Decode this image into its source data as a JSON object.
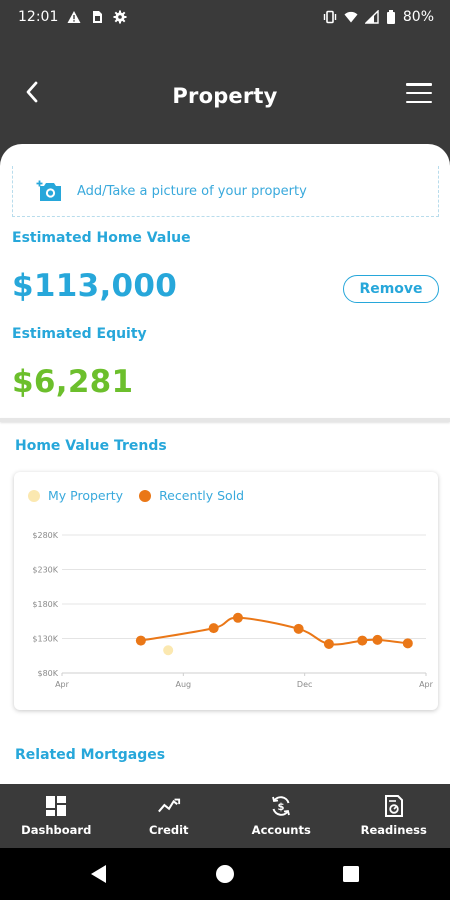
{
  "status_bar": {
    "time": "12:01",
    "battery": "80%",
    "left_icons": [
      "warning-icon",
      "sim-icon",
      "gear-icon"
    ],
    "right_icons": [
      "vibrate-icon",
      "wifi-icon",
      "signal-icon",
      "battery-icon"
    ]
  },
  "header": {
    "title": "Property",
    "back_icon": "chevron-left-icon",
    "menu_icon": "hamburger-menu-icon"
  },
  "photo": {
    "text": "Add/Take a picture of your property",
    "icon": "add-camera-icon"
  },
  "estimate": {
    "home_value_label": "Estimated Home Value",
    "home_value": "$113,000",
    "remove_label": "Remove",
    "equity_label": "Estimated Equity",
    "equity_value": "$6,281"
  },
  "trends": {
    "title": "Home Value Trends"
  },
  "colors": {
    "accent_blue": "#27a7da",
    "equity_green": "#6cbf2c",
    "my_property": "#fbe8b0",
    "recently_sold": "#ea7717"
  },
  "chart_data": {
    "type": "scatter",
    "legend": [
      "My Property",
      "Recently Sold"
    ],
    "legend_position": "top-left",
    "grid": true,
    "y_tick_labels": [
      "$80K",
      "$130K",
      "$180K",
      "$230K",
      "$280K"
    ],
    "x_tick_labels": [
      "Apr",
      "Aug",
      "Dec",
      "Apr"
    ],
    "ylim": [
      80000,
      280000
    ],
    "x_months": [
      0,
      12
    ],
    "series": [
      {
        "name": "My Property",
        "points": [
          {
            "x": 3.5,
            "y": 113000
          }
        ]
      },
      {
        "name": "Recently Sold",
        "trend_line": true,
        "points": [
          {
            "x": 2.6,
            "y": 127000
          },
          {
            "x": 5.0,
            "y": 145000
          },
          {
            "x": 5.8,
            "y": 160000
          },
          {
            "x": 7.8,
            "y": 144000
          },
          {
            "x": 8.8,
            "y": 122000
          },
          {
            "x": 9.9,
            "y": 127000
          },
          {
            "x": 10.4,
            "y": 128000
          },
          {
            "x": 11.4,
            "y": 123000
          }
        ]
      }
    ]
  },
  "related": {
    "title": "Related Mortgages"
  },
  "bottom_nav": {
    "items": [
      {
        "label": "Dashboard",
        "icon": "dashboard-icon"
      },
      {
        "label": "Credit",
        "icon": "trend-icon"
      },
      {
        "label": "Accounts",
        "icon": "accounts-icon"
      },
      {
        "label": "Readiness",
        "icon": "readiness-icon"
      }
    ]
  }
}
